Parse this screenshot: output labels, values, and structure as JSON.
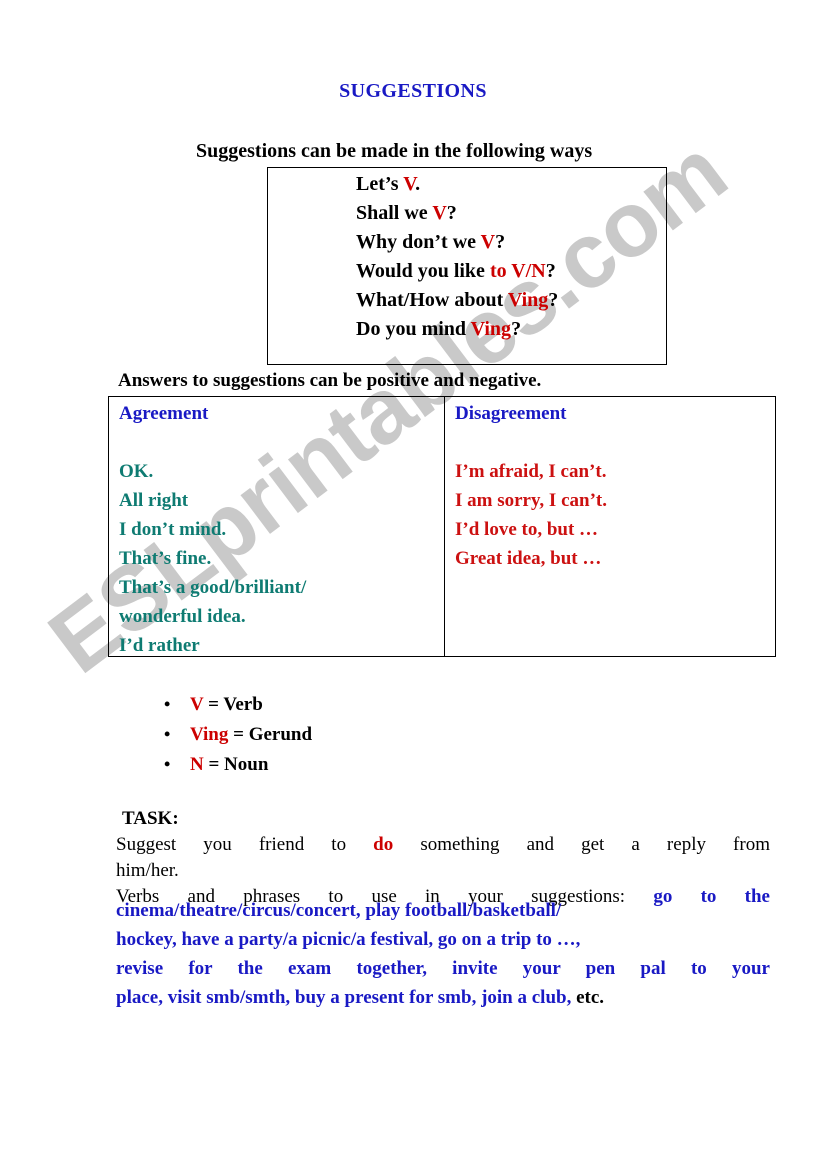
{
  "document": {
    "title": "SUGGESTIONS",
    "subtitle": "Suggestions can be made in the following ways",
    "watermark": "ESLprintables.com"
  },
  "colors": {
    "title_blue": "#1919c4",
    "accent_red": "#cc0000",
    "agreement_teal": "#0e7b72",
    "disagreement_red": "#cc1111",
    "phrase_blue": "#1919c4",
    "text_black": "#000000",
    "border": "#000000",
    "watermark_gray": "#c9c9c9"
  },
  "pattern_box": {
    "lines": [
      {
        "plain_1": "Let’s ",
        "highlight": "V",
        "plain_2": "."
      },
      {
        "plain_1": "Shall we ",
        "highlight": "V",
        "plain_2": "?"
      },
      {
        "plain_1": "Why don’t we ",
        "highlight": "V",
        "plain_2": "?"
      },
      {
        "plain_1": "Would you like ",
        "highlight": "to V/N",
        "plain_2": "?"
      },
      {
        "plain_1": "What/How about ",
        "highlight": "Ving",
        "plain_2": "?"
      },
      {
        "plain_1": "Do you mind ",
        "highlight": "Ving",
        "plain_2": "?"
      }
    ]
  },
  "answers": {
    "caption": "Answers to suggestions can be positive and negative.",
    "agreement": {
      "heading": "Agreement",
      "items": [
        "OK.",
        "All right",
        "I don’t mind.",
        "That’s fine.",
        "That’s a good/brilliant/",
        "wonderful idea.",
        "I’d rather"
      ]
    },
    "disagreement": {
      "heading": "Disagreement",
      "items": [
        "I’m afraid, I can’t.",
        "I am sorry, I can’t.",
        "I’d love to, but …",
        "Great idea, but …"
      ]
    }
  },
  "key": {
    "items": [
      {
        "symbol": "V",
        "definition": " = Verb"
      },
      {
        "symbol": "Ving",
        "definition": "  = Gerund"
      },
      {
        "symbol": "N",
        "definition": " =  Noun"
      }
    ]
  },
  "task": {
    "label": "TASK:",
    "line_1_part_1": "Suggest  you  friend  to  ",
    "line_1_highlight": "do",
    "line_1_part_2": "  something  and  get  a  reply  from",
    "line_2": "him/her.",
    "line_3_part_1": "Verbs  and  phrases  to  use  in  your  suggestions: ",
    "line_3_phrase": "go  to  the",
    "verbs_lines": [
      "cinema/theatre/circus/concert, play football/basketball/",
      "hockey, have a party/a picnic/a festival, go on a trip to …,",
      "revise  for  the  exam  together,   invite  your  pen  pal  to  your",
      "place, visit smb/smth, buy a present for smb, join a club,"
    ],
    "verbs_tail": " etc."
  }
}
